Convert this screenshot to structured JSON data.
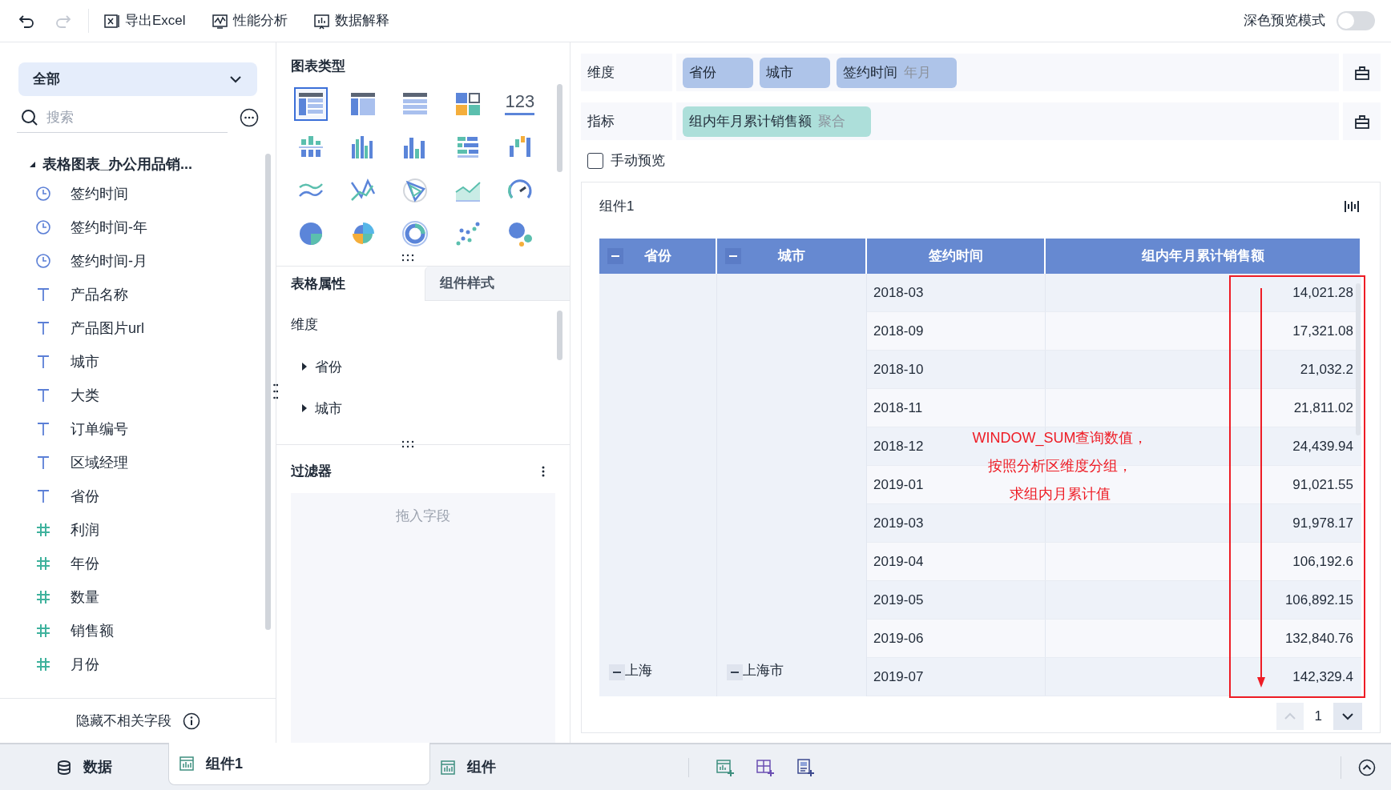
{
  "toolbar": {
    "items": [
      {
        "kind": "excel",
        "label": "导出Excel"
      },
      {
        "kind": "performance",
        "label": "性能分析"
      },
      {
        "kind": "explain",
        "label": "数据解释"
      }
    ],
    "dark_preview": {
      "label": "深色预览模式",
      "on": false
    }
  },
  "fields_panel": {
    "dropdown": "全部",
    "search": {
      "placeholder": "搜索"
    },
    "dataset": {
      "label": "表格图表_办公用品销...",
      "expanded": true,
      "children": [
        {
          "kind": "time",
          "label": "签约时间"
        },
        {
          "kind": "time",
          "label": "签约时间-年"
        },
        {
          "kind": "time",
          "label": "签约时间-月"
        },
        {
          "kind": "text",
          "label": "产品名称"
        },
        {
          "kind": "text",
          "label": "产品图片url"
        },
        {
          "kind": "text",
          "label": "城市"
        },
        {
          "kind": "text",
          "label": "大类"
        },
        {
          "kind": "text",
          "label": "订单编号"
        },
        {
          "kind": "text",
          "label": "区域经理"
        },
        {
          "kind": "text",
          "label": "省份"
        },
        {
          "kind": "number",
          "label": "利润"
        },
        {
          "kind": "number",
          "label": "年份"
        },
        {
          "kind": "number",
          "label": "数量"
        },
        {
          "kind": "number",
          "label": "销售额"
        },
        {
          "kind": "number",
          "label": "月份"
        }
      ]
    },
    "hide_button": "隐藏不相关字段"
  },
  "config_panel": {
    "chart_type_title": "图表类型",
    "chart_types": [
      {
        "kind": "table",
        "selected": true
      },
      {
        "kind": "cross-table",
        "selected": false
      },
      {
        "kind": "detail-table",
        "selected": false
      },
      {
        "kind": "cards",
        "selected": false
      },
      {
        "kind": "number",
        "label": "123",
        "selected": false
      },
      {
        "kind": "stacked-bar",
        "selected": false
      },
      {
        "kind": "grouped-bar",
        "selected": false
      },
      {
        "kind": "bar",
        "selected": false
      },
      {
        "kind": "horizontal-bar",
        "selected": false
      },
      {
        "kind": "waterfall",
        "selected": false
      },
      {
        "kind": "multi-line",
        "selected": false
      },
      {
        "kind": "line",
        "selected": false
      },
      {
        "kind": "radar",
        "selected": false
      },
      {
        "kind": "area",
        "selected": false
      },
      {
        "kind": "gauge",
        "selected": false
      },
      {
        "kind": "pie",
        "selected": false
      },
      {
        "kind": "rose",
        "selected": false
      },
      {
        "kind": "ring",
        "selected": false
      },
      {
        "kind": "scatter",
        "selected": false
      },
      {
        "kind": "bubble",
        "selected": false
      }
    ],
    "tabs": [
      {
        "label": "表格属性",
        "selected": true
      },
      {
        "label": "组件样式",
        "selected": false
      }
    ],
    "dimension_title": "维度",
    "dimension_items": [
      {
        "label": "省份",
        "expanded": false
      },
      {
        "label": "城市",
        "expanded": false
      }
    ],
    "filter": {
      "title": "过滤器",
      "placeholder": "拖入字段"
    }
  },
  "analysis_panel": {
    "shelves": [
      {
        "label": "维度",
        "color": "#aec4e9",
        "pills": [
          {
            "label": "省份"
          },
          {
            "label": "城市"
          },
          {
            "label": "签约时间",
            "suffix": "年月"
          }
        ]
      },
      {
        "label": "指标",
        "color": "#addfda",
        "pills": [
          {
            "label": "组内年月累计销售额",
            "suffix": "聚合"
          }
        ]
      }
    ],
    "manual_preview": {
      "label": "手动预览",
      "checked": false
    },
    "component": {
      "title": "组件1",
      "table": {
        "columns": [
          {
            "label": "省份",
            "collapsible": true
          },
          {
            "label": "城市",
            "collapsible": true
          },
          {
            "label": "签约时间",
            "collapsible": false
          },
          {
            "label": "组内年月累计销售额",
            "collapsible": false
          }
        ],
        "province": "上海",
        "city": "上海市",
        "rows": [
          {
            "date": "2018-03",
            "value": "14,021.28"
          },
          {
            "date": "2018-09",
            "value": "17,321.08"
          },
          {
            "date": "2018-10",
            "value": "21,032.2"
          },
          {
            "date": "2018-11",
            "value": "21,811.02"
          },
          {
            "date": "2018-12",
            "value": "24,439.94"
          },
          {
            "date": "2019-01",
            "value": "91,021.55"
          },
          {
            "date": "2019-03",
            "value": "91,978.17"
          },
          {
            "date": "2019-04",
            "value": "106,192.6"
          },
          {
            "date": "2019-05",
            "value": "106,892.15"
          },
          {
            "date": "2019-06",
            "value": "132,840.76"
          },
          {
            "date": "2019-07",
            "value": "142,329.4"
          }
        ]
      },
      "annotation": [
        "WINDOW_SUM查询数值，",
        "按照分析区维度分组，",
        "求组内月累计值"
      ],
      "page": "1"
    }
  },
  "bottom_tabs": [
    {
      "kind": "data",
      "label": "数据",
      "selected": false
    },
    {
      "kind": "chart",
      "label": "组件1",
      "selected": true
    },
    {
      "kind": "chart",
      "label": "组件",
      "selected": false
    }
  ]
}
